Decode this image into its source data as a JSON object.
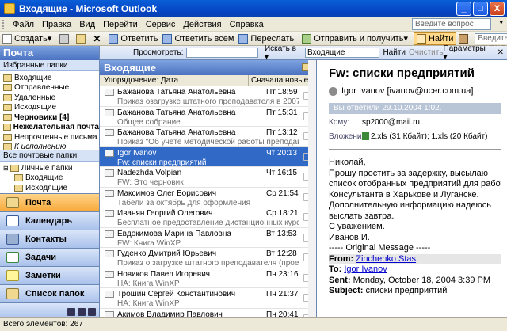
{
  "window": {
    "title": "Входящие - Microsoft Outlook",
    "minimize": "_",
    "maximize": "□",
    "close": "X"
  },
  "menu": {
    "items": [
      "Файл",
      "Правка",
      "Вид",
      "Перейти",
      "Сервис",
      "Действия",
      "Справка"
    ],
    "ask_placeholder": "Введите вопрос"
  },
  "toolbar": {
    "create": "Создать",
    "reply": "Ответить",
    "reply_all": "Ответить всем",
    "forward": "Переслать",
    "send_receive": "Отправить и получить",
    "find": "Найти",
    "contact_placeholder": "Введите контакт"
  },
  "nav": {
    "header": "Почта",
    "fav_label": "Избранные папки",
    "fav_folders": [
      "Входящие",
      "Отправленные",
      "Удаленные",
      "Исходящие",
      "Черновики [4]",
      "Нежелательная почта",
      "Непрочтенные письма",
      "К исполнению"
    ],
    "all_label": "Все почтовые папки",
    "tree": [
      "Личные папки",
      "Входящие",
      "Исходящие"
    ],
    "buttons": [
      "Почта",
      "Календарь",
      "Контакты",
      "Задачи",
      "Заметки",
      "Список папок"
    ]
  },
  "findbar": {
    "look_label": "Просмотреть:",
    "search_in": "Искать в ▾",
    "scope": "Входящие",
    "find_btn": "Найти",
    "clear_btn": "Очистить",
    "options": "Параметры ▾"
  },
  "list": {
    "folder": "Входящие",
    "sort_by": "Упорядочение: Дата",
    "sort_order": "Сначала новые",
    "messages": [
      {
        "from": "Бажанова Татьяна Анатольевна",
        "time": "Пт 18:59",
        "subject": "Приказ озагрузке штатного преподавателя в 2007-2008 учебн"
      },
      {
        "from": "Бажанова Татьяна Анатольевна",
        "time": "Пт 15:31",
        "subject": "Общее собрание ."
      },
      {
        "from": "Бажанова Татьяна Анатольевна",
        "time": "Пт 13:12",
        "subject": "Приказ \"Об учёте методической работы преподавател..."
      },
      {
        "from": "Igor Ivanov",
        "time": "Чт 20:13",
        "subject": "Fw: списки предприятий"
      },
      {
        "from": "Nadezhda Volpian",
        "time": "Чт 16:15",
        "subject": "FW: Это черновик"
      },
      {
        "from": "Максимов Олег Борисович",
        "time": "Ср 21:54",
        "subject": "Табели за октябрь для оформления"
      },
      {
        "from": "Иванян Георгий Олегович",
        "time": "Ср 18:21",
        "subject": "Бесплатное предоставление дистанционных курсов сту..."
      },
      {
        "from": "Евдокимова Марина Павловна",
        "time": "Вт 13:53",
        "subject": "FW: Книга WinXP"
      },
      {
        "from": "Гуденко Дмитрий Юрьевич",
        "time": "Вт 12:28",
        "subject": "Приказ о загрузке штатного преподавателя (проект)"
      },
      {
        "from": "Новиков Павел Игоревич",
        "time": "Пн 23:16",
        "subject": "НА: Книга WinXP"
      },
      {
        "from": "Трошин Сергей Константинович",
        "time": "Пн 21:37",
        "subject": "НА: Книга WinXP"
      },
      {
        "from": "Акимов Владимир Павлович",
        "time": "Пн 20:41",
        "subject": ""
      }
    ]
  },
  "reading": {
    "subject": "Fw: списки предприятий",
    "sender": "Igor Ivanov [ivanov@ucer.com.ua]",
    "info": "Вы ответили 29.10.2004 1:02.",
    "to_label": "Кому:",
    "to": "sp2000@mail.ru",
    "att_label": "Вложения:",
    "attachments": "2.xls (31 Кбайт); 1.xls (20 Кбайт)",
    "body": [
      "Николай,",
      "Прошу простить за задержку, высылаю",
      "список отобранных предприятий для работы",
      "Консультанта в Харькове и Луганске.",
      "Дополнительную информацию надеюсь",
      "выслать завтра.",
      "С уважением.",
      "Иванов И."
    ],
    "orig": "----- Original Message -----",
    "from_label": "From:",
    "from_val": "Zinchenko Stas",
    "to2_label": "To:",
    "to2_val": "Igor Ivanov",
    "sent_label": "Sent:",
    "sent_val": "Monday, October 18, 2004 3:39 PM",
    "subj_label": "Subject:",
    "subj_val": "списки предприятий"
  },
  "status": "Всего элементов: 267"
}
